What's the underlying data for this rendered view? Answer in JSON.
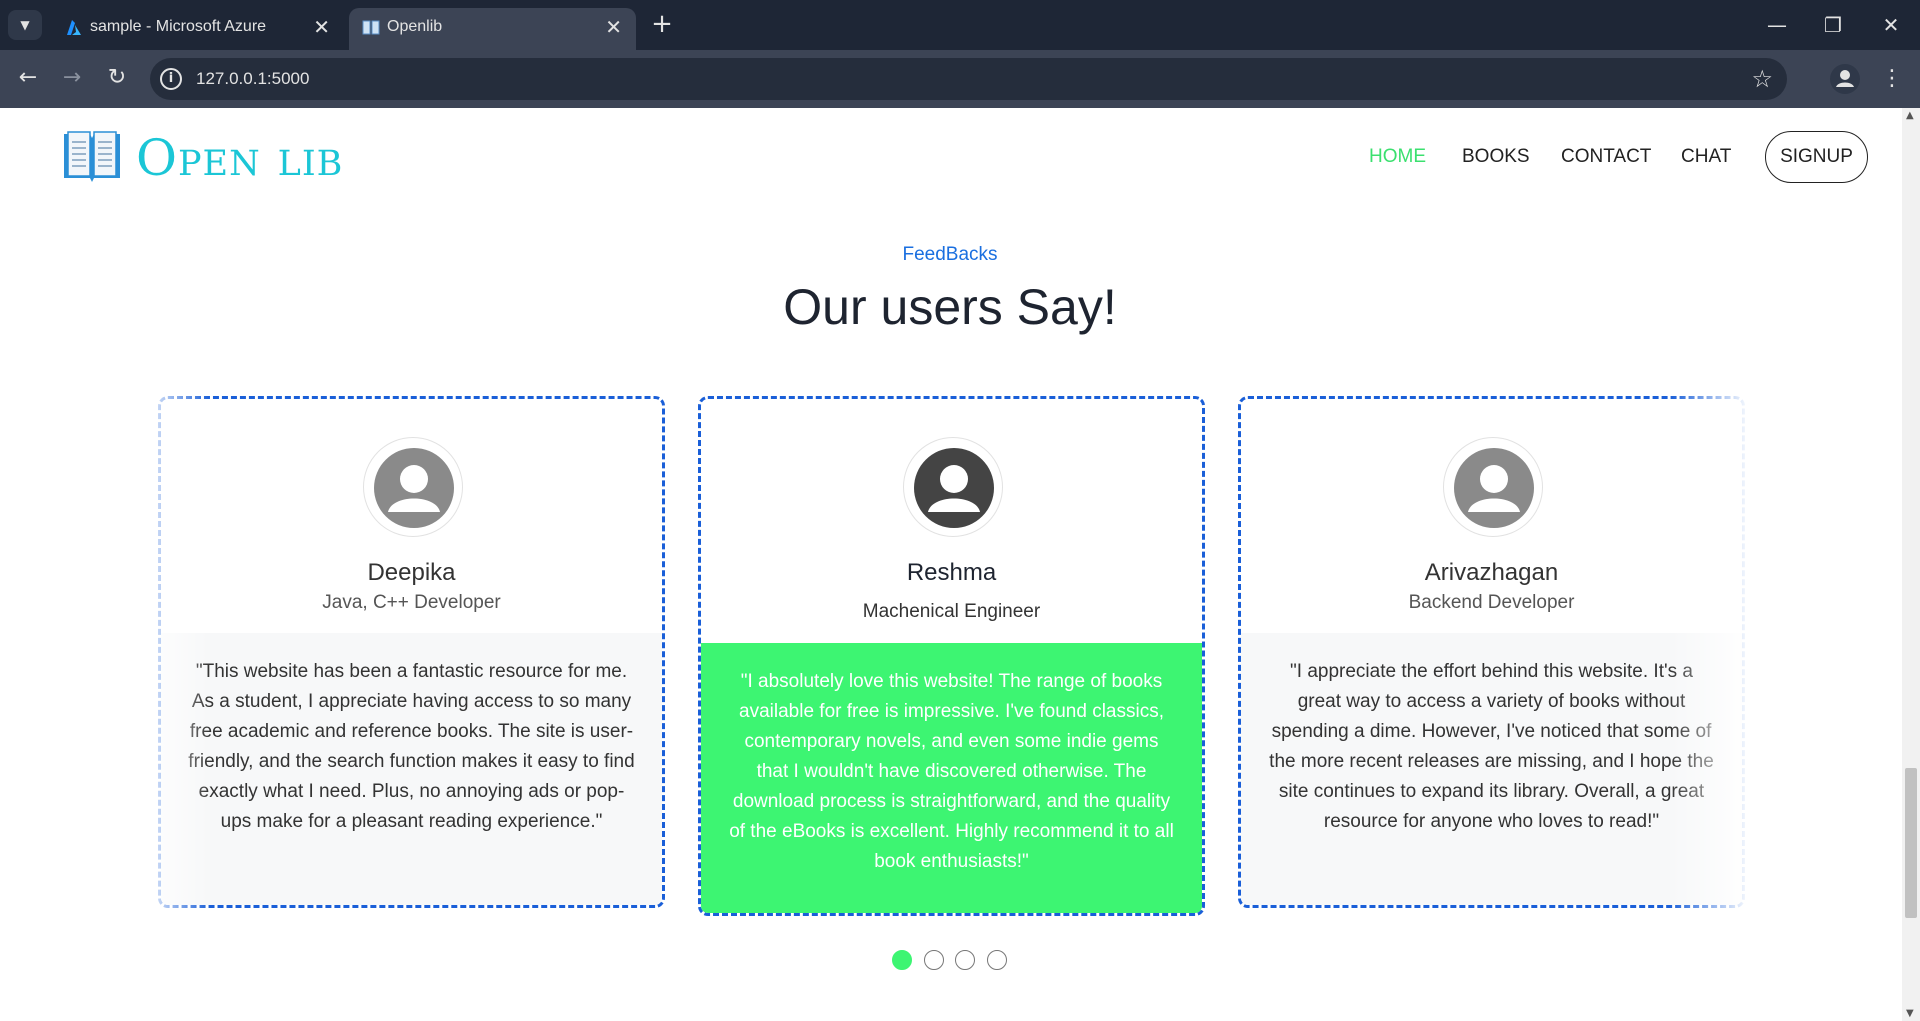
{
  "browser": {
    "tabs": [
      {
        "title": "sample - Microsoft Azure",
        "icon": "azure-icon",
        "active": false
      },
      {
        "title": "Openlib",
        "icon": "book-icon",
        "active": true
      }
    ],
    "close_glyph": "✕",
    "new_tab_glyph": "+",
    "url": "127.0.0.1:5000",
    "window_controls": {
      "minimize": "—",
      "restore": "❐",
      "close": "✕"
    }
  },
  "site": {
    "logo_text": "Open lib",
    "nav": {
      "home": "HOME",
      "books": "BOOKS",
      "contact": "CONTACT",
      "chat": "CHAT",
      "signup": "SIGNUP"
    },
    "colors": {
      "accent_green": "#3df572",
      "brand_cyan": "#1bc6d6",
      "link_blue": "#1a6fe0"
    }
  },
  "feedback": {
    "eyebrow": "FeedBacks",
    "heading": "Our users Say!",
    "cards": [
      {
        "name": "Deepika",
        "role": "Java, C++ Developer",
        "quote": "\"This website has been a fantastic resource for me. As a student, I appreciate having access to so many free academic and reference books. The site is user-friendly, and the search function makes it easy to find exactly what I need. Plus, no annoying ads or pop-ups make for a pleasant reading experience.\""
      },
      {
        "name": "Reshma",
        "role": "Machenical Engineer",
        "quote": "\"I absolutely love this website! The range of books available for free is impressive. I've found classics, contemporary novels, and even some indie gems that I wouldn't have discovered otherwise. The download process is straightforward, and the quality of the eBooks is excellent. Highly recommend it to all book enthusiasts!\""
      },
      {
        "name": "Arivazhagan",
        "role": "Backend Developer",
        "quote": "\"I appreciate the effort behind this website. It's a great way to access a variety of books without spending a dime. However, I've noticed that some of the more recent releases are missing, and I hope the site continues to expand its library. Overall, a great resource for anyone who loves to read!\""
      }
    ],
    "pagination": {
      "count": 4,
      "active_index": 0
    }
  }
}
